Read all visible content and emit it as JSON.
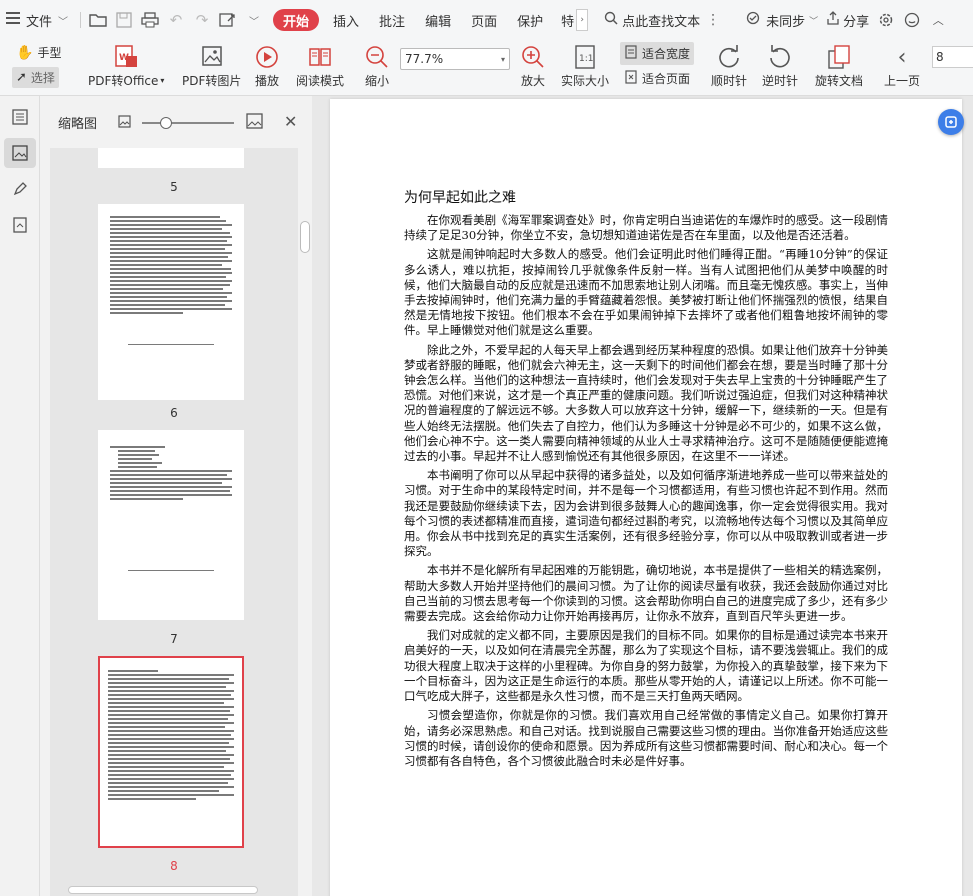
{
  "menubar": {
    "file_label": "文件",
    "tabs": [
      "开始",
      "插入",
      "批注",
      "编辑",
      "页面",
      "保护",
      "特"
    ],
    "search_label": "点此查找文本",
    "sync_label": "未同步",
    "share_label": "分享"
  },
  "toolbar": {
    "hand_label": "手型",
    "select_label": "选择",
    "pdf_office_label": "PDF转Office",
    "pdf_image_label": "PDF转图片",
    "play_label": "播放",
    "read_mode_label": "阅读模式",
    "zoom_out_label": "缩小",
    "zoom_value": "77.7%",
    "zoom_in_label": "放大",
    "actual_size_label": "实际大小",
    "fit_width_label": "适合宽度",
    "fit_page_label": "适合页面",
    "clockwise_label": "顺时针",
    "counterclockwise_label": "逆时针",
    "rotate_doc_label": "旋转文档",
    "prev_page_label": "上一页",
    "page_number": "8"
  },
  "thumbnail_panel": {
    "title": "缩略图",
    "pages": [
      {
        "label": "5"
      },
      {
        "label": "6"
      },
      {
        "label": "7"
      },
      {
        "label": "8",
        "selected": true
      }
    ],
    "accent_color": "#e0414a"
  },
  "document": {
    "title": "为何早起如此之难",
    "paragraphs": [
      "在你观看美剧《海军罪案调查处》时，你肯定明白当迪诺佐的车爆炸时的感受。这一段剧情持续了足足30分钟，你坐立不安，急切想知道迪诺佐是否在车里面，以及他是否还活着。",
      "这就是闹钟响起时大多数人的感受。他们会证明此时他们睡得正酣。“再睡10分钟”的保证多么诱人，难以抗拒，按掉闹铃几乎就像条件反射一样。当有人试图把他们从美梦中唤醒的时候，他们大脑最自动的反应就是迅速而不加思索地让别人闭嘴。而且毫无愧疚感。事实上，当伸手去按掉闹钟时，他们充满力量的手臂蕴藏着怨恨。美梦被打断让他们怀揣强烈的愤恨，结果自然是无情地按下按钮。他们根本不会在乎如果闹钟掉下去摔坏了或者他们粗鲁地按坏闹钟的零件。早上睡懒觉对他们就是这么重要。",
      "除此之外，不爱早起的人每天早上都会遇到经历某种程度的恐惧。如果让他们放弃十分钟美梦或者舒服的睡眠，他们就会六神无主，这一天剩下的时间他们都会在想，要是当时睡了那十分钟会怎么样。当他们的这种想法一直持续时，他们会发现对于失去早上宝贵的十分钟睡眠产生了恐慌。对他们来说，这才是一个真正严重的健康问题。我们听说过强迫症，但我们对这种精神状况的普遍程度的了解远远不够。大多数人可以放弃这十分钟，缓解一下，继续新的一天。但是有些人始终无法摆脱。他们失去了自控力，他们认为多睡这十分钟是必不可少的，如果不这么做，他们会心神不宁。这一类人需要向精神领域的从业人士寻求精神治疗。这可不是随随便便能遮掩过去的小事。早起并不让人感到愉悦还有其他很多原因，在这里不一一详述。",
      "本书阐明了你可以从早起中获得的诸多益处，以及如何循序渐进地养成一些可以带来益处的习惯。对于生命中的某段特定时间，并不是每一个习惯都适用，有些习惯也许起不到作用。然而我还是要鼓励你继续读下去，因为会讲到很多鼓舞人心的趣闻逸事，你一定会觉得很实用。我对每个习惯的表述都精准而直接，遣词造句都经过斟酌考究，以流畅地传达每个习惯以及其简单应用。你会从书中找到充足的真实生活案例，还有很多经验分享，你可以从中吸取教训或者进一步探究。",
      "本书并不是化解所有早起困难的万能钥匙，确切地说，本书是提供了一些相关的精选案例，帮助大多数人开始并坚持他们的晨间习惯。为了让你的阅读尽量有收获，我还会鼓励你通过对比自己当前的习惯去思考每一个你读到的习惯。这会帮助你明白自己的进度完成了多少，还有多少需要去完成。这会给你动力让你开始再接再厉，让你永不放弃，直到百尺竿头更进一步。",
      "我们对成就的定义都不同，主要原因是我们的目标不同。如果你的目标是通过读完本书来开启美好的一天，以及如何在清晨完全苏醒，那么为了实现这个目标，请不要浅尝辄止。我们的成功很大程度上取决于这样的小里程碑。为你自身的努力鼓掌，为你投入的真挚鼓掌，接下来为下一个目标奋斗，因为这正是生命运行的本质。那些从零开始的人，请谨记以上所述。你不可能一口气吃成大胖子，这些都是永久性习惯，而不是三天打鱼两天晒网。",
      "习惯会塑造你，你就是你的习惯。我们喜欢用自己经常做的事情定义自己。如果你打算开始，请务必深思熟虑。和自己对话。找到说服自己需要这些习惯的理由。当你准备开始适应这些习惯的时候，请创设你的使命和愿景。因为养成所有这些习惯都需要时间、耐心和决心。每一个习惯都有各自特色，各个习惯彼此融合时未必是件好事。"
    ]
  }
}
